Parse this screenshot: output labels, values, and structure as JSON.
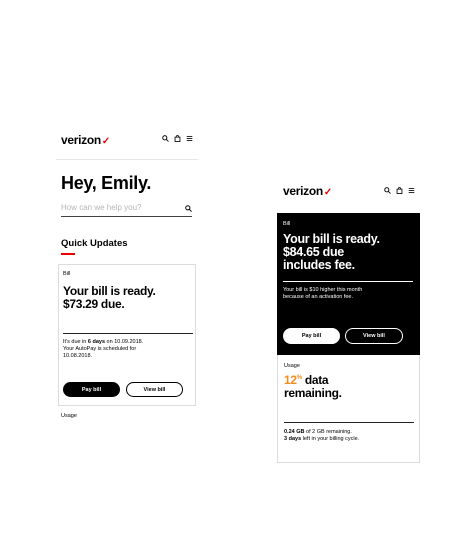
{
  "brand": {
    "logo_text": "verizon",
    "logo_check": "✓",
    "accent_color": "#ee0000",
    "highlight_color": "#f28c1e"
  },
  "header_icons": [
    "search-icon",
    "bag-icon",
    "menu-icon"
  ],
  "left": {
    "greeting": "Hey, Emily.",
    "search": {
      "placeholder": "How can we help you?"
    },
    "quick_updates": "Quick Updates",
    "bill_card": {
      "label": "Bill",
      "headline_1": "Your bill is ready.",
      "headline_2": "$73.29 due.",
      "due_prefix": "It's due in ",
      "due_days": "6 days",
      "due_suffix": " on 10.09.2018.",
      "autopay_1": "Your AutoPay is scheduled for",
      "autopay_2": "10.08.2018.",
      "pay_label": "Pay bill",
      "view_label": "View bill"
    },
    "cut_off_text": "Usage"
  },
  "right": {
    "bill_card": {
      "label": "Bill",
      "headline_1": "Your bill is ready.",
      "headline_2": "$84.65 due",
      "headline_3": "includes fee.",
      "note_1": "Your bill is $10 higher this month",
      "note_2": "because of an activation fee.",
      "pay_label": "Pay bill",
      "view_label": "View bill"
    },
    "usage_card": {
      "label": "Usage",
      "percent_value": "12",
      "percent_sign": "%",
      "headline_1_rest": " data",
      "headline_2": "remaining.",
      "gb_used": "0.24 GB",
      "gb_suffix": " of 2 GB remaining.",
      "days_left": "3 days",
      "days_suffix": " left in your billing cycle."
    }
  }
}
